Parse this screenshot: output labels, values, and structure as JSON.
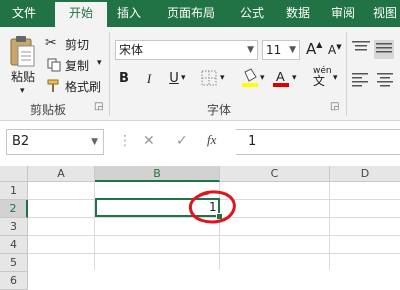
{
  "tabs": [
    "文件",
    "开始",
    "插入",
    "页面布局",
    "公式",
    "数据",
    "审阅",
    "视图"
  ],
  "active_tab": "开始",
  "clipboard": {
    "paste": "粘贴",
    "cut": "剪切",
    "copy": "复制",
    "format_painter": "格式刷",
    "group_label": "剪贴板"
  },
  "font": {
    "name": "宋体",
    "size": "11",
    "bold": "B",
    "italic": "I",
    "underline": "U",
    "grow": "A",
    "shrink": "A",
    "phonetic": "wén",
    "group_label": "字体",
    "font_color": "#e00000",
    "fill_color": "#ffff00"
  },
  "formula_bar": {
    "name_box": "B2",
    "fx": "fx",
    "value": "1"
  },
  "grid": {
    "columns": [
      "A",
      "B",
      "C",
      "D"
    ],
    "rows": [
      "1",
      "2",
      "3",
      "4",
      "5",
      "6"
    ],
    "selected_cell": "B2",
    "cells": {
      "B2": "1"
    }
  },
  "colors": {
    "accent": "#217346",
    "annotation": "#e0141e"
  }
}
